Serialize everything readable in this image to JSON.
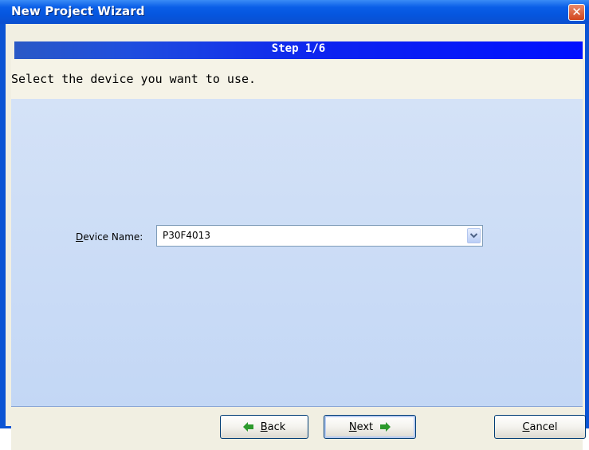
{
  "window": {
    "title": "New Project Wizard"
  },
  "step": {
    "label": "Step 1/6"
  },
  "instruction": "Select the device you want to use.",
  "device": {
    "label": "Device Name:",
    "value": "P30F4013"
  },
  "buttons": {
    "back": "Back",
    "next": "Next",
    "cancel": "Cancel"
  },
  "icons": {
    "close": "close-icon",
    "dropdown": "chevron-down-icon",
    "back_arrow": "arrow-left-icon",
    "next_arrow": "arrow-right-icon"
  },
  "colors": {
    "titlebar": "#0a5fe8",
    "step_banner": "#0d23f0",
    "panel": "#c3d7f5",
    "arrow_green": "#2c9a2c"
  }
}
